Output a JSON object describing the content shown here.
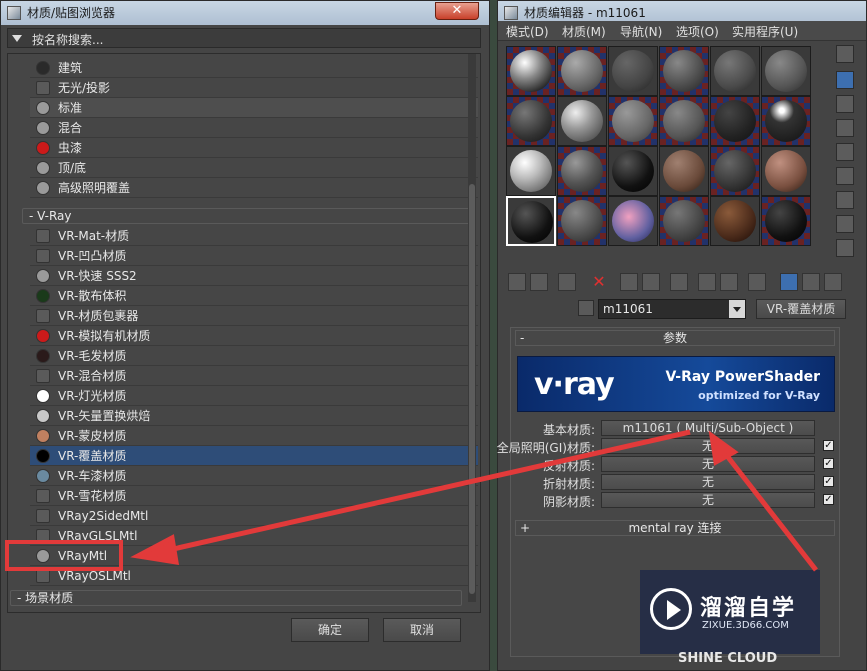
{
  "browser": {
    "title": "材质/贴图浏览器",
    "close": "✕",
    "search_placeholder": "按名称搜索...",
    "top_items": [
      {
        "label": "建筑",
        "swatch": "#2a2a2a"
      },
      {
        "label": "无光/投影",
        "swatch": "#5a5a5a"
      },
      {
        "label": "标准",
        "swatch": "#9a9a9a"
      },
      {
        "label": "混合",
        "swatch": "#9a9a9a"
      },
      {
        "label": "虫漆",
        "swatch": "#cc1a1a"
      },
      {
        "label": "顶/底",
        "swatch": "#9a9a9a"
      },
      {
        "label": "高级照明覆盖",
        "swatch": "#9a9a9a"
      }
    ],
    "vray_section": "- V-Ray",
    "vray_items": [
      {
        "label": "VR-Mat-材质",
        "swatch": "#5a5a5a"
      },
      {
        "label": "VR-凹凸材质",
        "swatch": "#5a5a5a"
      },
      {
        "label": "VR-快速 SSS2",
        "swatch": "#9a9a9a"
      },
      {
        "label": "VR-散布体积",
        "swatch": "#1a3a1a"
      },
      {
        "label": "VR-材质包裹器",
        "swatch": "#5a5a5a"
      },
      {
        "label": "VR-模拟有机材质",
        "swatch": "#cc1a1a"
      },
      {
        "label": "VR-毛发材质",
        "swatch": "#2a1a1a"
      },
      {
        "label": "VR-混合材质",
        "swatch": "#5a5a5a"
      },
      {
        "label": "VR-灯光材质",
        "swatch": "#ffffff"
      },
      {
        "label": "VR-矢量置换烘焙",
        "swatch": "#c8c8c8"
      },
      {
        "label": "VR-蒙皮材质",
        "swatch": "#c08060"
      },
      {
        "label": "VR-覆盖材质",
        "swatch": "#000000"
      },
      {
        "label": "VR-车漆材质",
        "swatch": "#6a8aa0"
      },
      {
        "label": "VR-雪花材质",
        "swatch": "#5a5a5a"
      },
      {
        "label": "VRay2SidedMtl",
        "swatch": "#5a5a5a"
      },
      {
        "label": "VRayGLSLMtl",
        "swatch": "#5a5a5a"
      },
      {
        "label": "VRayMtl",
        "swatch": "#9a9a9a"
      },
      {
        "label": "VRayOSLMtl",
        "swatch": "#5a5a5a"
      }
    ],
    "scene_section": "- 场景材质",
    "ok": "确定",
    "cancel": "取消"
  },
  "editor": {
    "title": "材质编辑器 - m11061",
    "menus": [
      "模式(D)",
      "材质(M)",
      "导航(N)",
      "选项(O)",
      "实用程序(U)"
    ],
    "material_name": "m11061",
    "material_type": "VR-覆盖材质",
    "params_title": "参数",
    "banner_logo": "v·ray",
    "banner_title": "V-Ray PowerShader",
    "banner_subtitle": "optimized for V-Ray",
    "params": [
      {
        "label": "基本材质:",
        "value": "m11061 ( Multi/Sub-Object )",
        "checkbox": false
      },
      {
        "label": "全局照明(GI)材质:",
        "value": "无",
        "checkbox": true
      },
      {
        "label": "反射材质:",
        "value": "无",
        "checkbox": true
      },
      {
        "label": "折射材质:",
        "value": "无",
        "checkbox": true
      },
      {
        "label": "阴影材质:",
        "value": "无",
        "checkbox": true
      }
    ],
    "checkmark": "✓",
    "mental_ray": "mental ray 连接"
  },
  "watermark": {
    "brand": "溜溜自学",
    "url": "ZIXUE.3D66.COM",
    "shine": "SHINE CLOUD"
  },
  "colors": {
    "highlight": "#e23a3a",
    "selected_row": "#2e4d78",
    "banner": "#154a9a"
  }
}
